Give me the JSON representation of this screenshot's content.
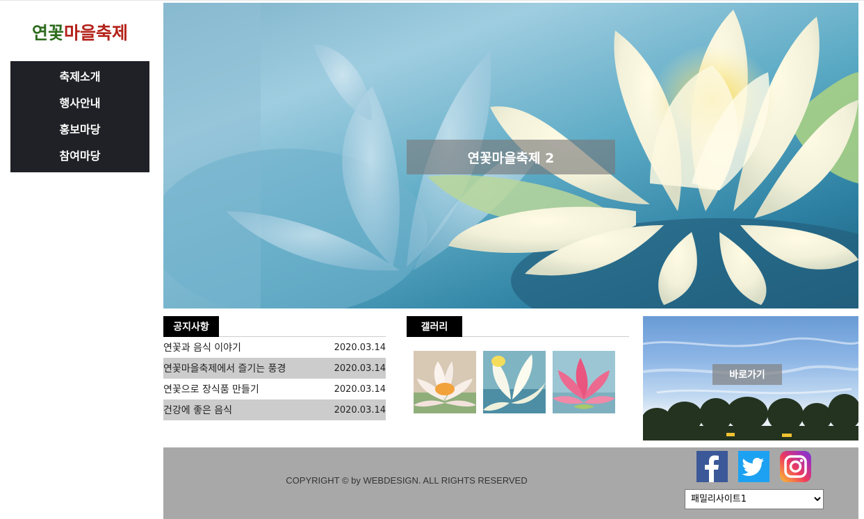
{
  "logo": {
    "part1": "연꽃",
    "part2": "마을축제"
  },
  "nav": [
    {
      "label": "축제소개"
    },
    {
      "label": "행사안내"
    },
    {
      "label": "홍보마당"
    },
    {
      "label": "참여마당"
    }
  ],
  "hero": {
    "caption": "연꽃마을축제 2"
  },
  "notice": {
    "title": "공지사항",
    "items": [
      {
        "text": "연꽃과 음식 이야기",
        "date": "2020.03.14"
      },
      {
        "text": "연꽃마을축제에서 즐기는 풍경",
        "date": "2020.03.14"
      },
      {
        "text": "연꽃으로 장식품 만들기",
        "date": "2020.03.14"
      },
      {
        "text": "건강에 좋은 음식",
        "date": "2020.03.14"
      }
    ]
  },
  "gallery": {
    "title": "갤러리"
  },
  "shortcut": {
    "label": "바로가기"
  },
  "footer": {
    "copyright": "COPYRIGHT © by WEBDESIGN. ALL RIGHTS RESERVED",
    "social": [
      "facebook-icon",
      "twitter-icon",
      "instagram-icon"
    ],
    "family_site": "패밀리사이트1"
  }
}
